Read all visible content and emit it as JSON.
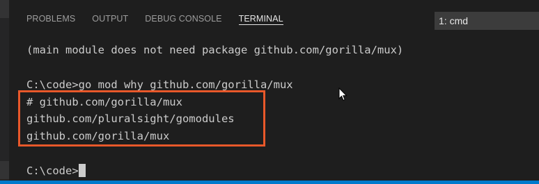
{
  "tabs": [
    {
      "label": "PROBLEMS",
      "active": false
    },
    {
      "label": "OUTPUT",
      "active": false
    },
    {
      "label": "DEBUG CONSOLE",
      "active": false
    },
    {
      "label": "TERMINAL",
      "active": true
    }
  ],
  "terminal_selector": {
    "value": "1: cmd"
  },
  "terminal": {
    "lines": [
      "(main module does not need package github.com/gorilla/mux)",
      "C:\\code>go mod why github.com/gorilla/mux",
      "# github.com/gorilla/mux",
      "github.com/pluralsight/gomodules",
      "github.com/gorilla/mux",
      "C:\\code>"
    ]
  },
  "colors": {
    "background": "#1e1e1e",
    "text": "#cccccc",
    "highlight_border": "#e8582a",
    "status_bar": "#007acc"
  }
}
